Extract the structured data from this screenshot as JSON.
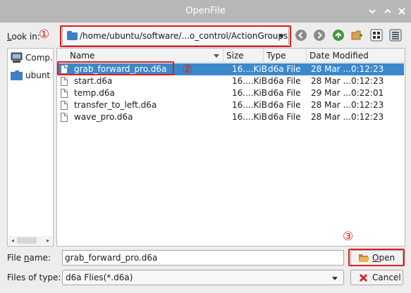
{
  "window": {
    "title": "OpenFile",
    "controls": [
      "chevron-down-icon",
      "chevron-up-icon",
      "close-icon"
    ]
  },
  "look_in": {
    "label_prefix": "",
    "label_mnemonic": "L",
    "label_rest": "ook in:",
    "annotation": "①",
    "path": "/home/ubuntu/software/...o_control/ActionGroups"
  },
  "toolbar": {
    "icons": [
      "back-icon",
      "forward-icon",
      "parent-directory-icon",
      "new-folder-icon",
      "list-view-icon",
      "detail-view-icon"
    ]
  },
  "sidebar": {
    "items": [
      {
        "label": "Comp...",
        "icon": "computer-icon"
      },
      {
        "label": "ubunt",
        "icon": "folder-icon"
      }
    ]
  },
  "file_list": {
    "columns": [
      "Name",
      "Size",
      "Type",
      "Date Modified"
    ],
    "rows": [
      {
        "name": "grab_forward_pro.d6a",
        "size": "16....KiB",
        "type": "d6a File",
        "date": "28 Mar ...0:12:23",
        "selected": true
      },
      {
        "name": "start.d6a",
        "size": "16....KiB",
        "type": "d6a File",
        "date": "28 Mar ...0:12:23",
        "selected": false
      },
      {
        "name": "temp.d6a",
        "size": "16....KiB",
        "type": "d6a File",
        "date": "29 Mar ...0:22:01",
        "selected": false
      },
      {
        "name": "transfer_to_left.d6a",
        "size": "16....KiB",
        "type": "d6a File",
        "date": "28 Mar ...0:12:23",
        "selected": false
      },
      {
        "name": "wave_pro.d6a",
        "size": "16....KiB",
        "type": "d6a File",
        "date": "28 Mar ...0:12:23",
        "selected": false
      }
    ],
    "annotation": "②"
  },
  "file_name": {
    "label_prefix": "File ",
    "label_mnemonic": "n",
    "label_rest": "ame:",
    "value": "grab_forward_pro.d6a"
  },
  "file_type": {
    "label": "Files of type:",
    "value": "d6a Flies(*.d6a)"
  },
  "buttons": {
    "open_mnemonic": "O",
    "open_rest": "pen",
    "open_annotation": "③",
    "cancel_label": "Cancel"
  },
  "colors": {
    "selection": "#3c88cc",
    "annotation_red": "#e21b1b",
    "titlebar": "#b7b7b7"
  }
}
